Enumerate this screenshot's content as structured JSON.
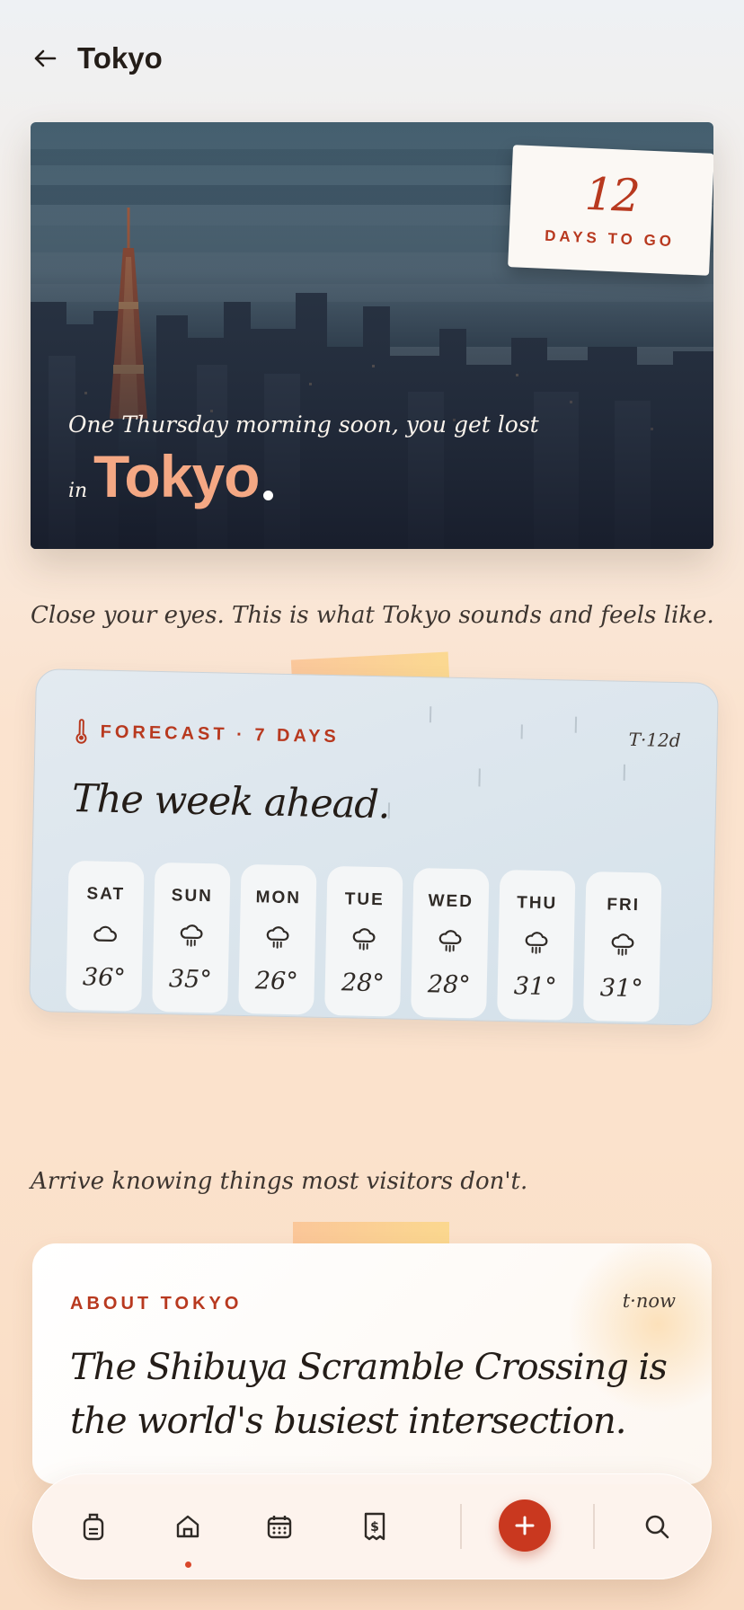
{
  "header": {
    "title": "Tokyo",
    "back_icon": "arrow-left-icon"
  },
  "hero": {
    "countdown_number": "12",
    "countdown_label": "DAYS TO GO",
    "subtitle": "One Thursday morning soon, you get lost",
    "in_word": "in",
    "city": "Tokyo"
  },
  "tagline_1": "Close your eyes. This is what Tokyo sounds and feels like.",
  "forecast": {
    "label": "FORECAST · 7 DAYS",
    "tag": "T·12d",
    "title": "The week ahead.",
    "icon": "thermometer-icon",
    "days": [
      {
        "name": "SAT",
        "icon": "cloud-icon",
        "temp": "36°"
      },
      {
        "name": "SUN",
        "icon": "rain-cloud-icon",
        "temp": "35°"
      },
      {
        "name": "MON",
        "icon": "rain-cloud-icon",
        "temp": "26°"
      },
      {
        "name": "TUE",
        "icon": "rain-cloud-icon",
        "temp": "28°"
      },
      {
        "name": "WED",
        "icon": "rain-cloud-icon",
        "temp": "28°"
      },
      {
        "name": "THU",
        "icon": "rain-cloud-icon",
        "temp": "31°"
      },
      {
        "name": "FRI",
        "icon": "rain-cloud-icon",
        "temp": "31°"
      }
    ]
  },
  "tagline_2": "Arrive knowing things most visitors don't.",
  "about": {
    "label": "ABOUT TOKYO",
    "tag": "t·now",
    "text": "The Shibuya Scramble Crossing is the world's busiest intersection."
  },
  "nav": {
    "items": [
      "luggage-icon",
      "home-icon",
      "calendar-icon",
      "receipt-icon",
      "add-icon",
      "search-icon"
    ],
    "active": "home-icon",
    "accent": "#c9381f"
  }
}
